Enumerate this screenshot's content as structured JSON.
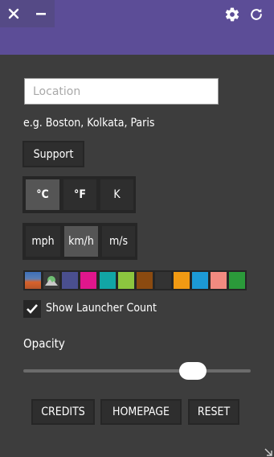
{
  "window": {
    "close_icon": "close-icon",
    "minimize_icon": "minimize-icon",
    "header_color": "#5c4d97"
  },
  "toolbar": {
    "settings_icon": "gear-icon",
    "refresh_icon": "refresh-icon"
  },
  "location": {
    "placeholder": "Location",
    "value": "",
    "example": "e.g. Boston, Kolkata, Paris"
  },
  "support_label": "Support",
  "temperature_units": {
    "options": [
      "°C",
      "°F",
      "K"
    ],
    "selected": "°C"
  },
  "wind_units": {
    "options": [
      "mph",
      "km/h",
      "m/s"
    ],
    "selected": "km/h"
  },
  "themes": [
    {
      "name": "gradient-blue-orange",
      "color": "#c8662a"
    },
    {
      "name": "landscape",
      "color": "#444444"
    },
    {
      "name": "slate-blue",
      "color": "#4a4f8f"
    },
    {
      "name": "magenta",
      "color": "#e0168c"
    },
    {
      "name": "teal",
      "color": "#12a5a5"
    },
    {
      "name": "lime",
      "color": "#8cc63f"
    },
    {
      "name": "brown",
      "color": "#8b4a10"
    },
    {
      "name": "charcoal",
      "color": "#333333"
    },
    {
      "name": "orange",
      "color": "#f19a13"
    },
    {
      "name": "sky-blue",
      "color": "#1c9ad6"
    },
    {
      "name": "salmon",
      "color": "#f28a80"
    },
    {
      "name": "green",
      "color": "#2b9a3a"
    }
  ],
  "launcher_count": {
    "label": "Show Launcher Count",
    "checked": true
  },
  "opacity": {
    "label": "Opacity",
    "value": 0.75
  },
  "footer": {
    "credits": "CREDITS",
    "homepage": "HOMEPAGE",
    "reset": "RESET"
  }
}
